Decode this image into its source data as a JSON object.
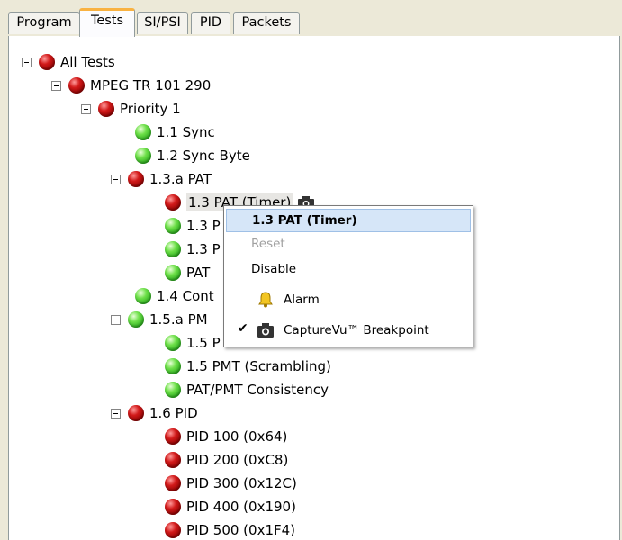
{
  "tabs": [
    {
      "label": "Program",
      "active": false
    },
    {
      "label": "Tests",
      "active": true
    },
    {
      "label": "SI/PSI",
      "active": false
    },
    {
      "label": "PID",
      "active": false
    },
    {
      "label": "Packets",
      "active": false
    }
  ],
  "tree": {
    "all_tests": "All Tests",
    "mpeg": "MPEG TR 101 290",
    "priority1": "Priority 1",
    "sync": "1.1 Sync",
    "sync_byte": "1.2 Sync Byte",
    "pat_a": "1.3.a PAT",
    "pat_timer": "1.3 PAT (Timer)",
    "pat_p2": "1.3 P",
    "pat_p3": "1.3 P",
    "pat_4": "PAT",
    "cont": "1.4 Cont",
    "pm_a": "1.5.a PM",
    "pmt_1": "1.5 P",
    "pmt_scrambling": "1.5 PMT (Scrambling)",
    "pat_pmt": "PAT/PMT Consistency",
    "pid_group": "1.6 PID",
    "pid_100": "PID 100 (0x64)",
    "pid_200": "PID 200 (0xC8)",
    "pid_300": "PID 300 (0x12C)",
    "pid_400": "PID 400 (0x190)",
    "pid_500": "PID 500 (0x1F4)"
  },
  "status_colors": {
    "fail": "#c81414",
    "pass": "#3cc22a"
  },
  "context_menu": {
    "title": "1.3 PAT (Timer)",
    "reset": "Reset",
    "disable": "Disable",
    "alarm": "Alarm",
    "capturevu": "CaptureVu™ Breakpoint",
    "check_mark": "✔"
  },
  "icons": {
    "alarm": "bell-icon",
    "capture": "camera-icon"
  }
}
